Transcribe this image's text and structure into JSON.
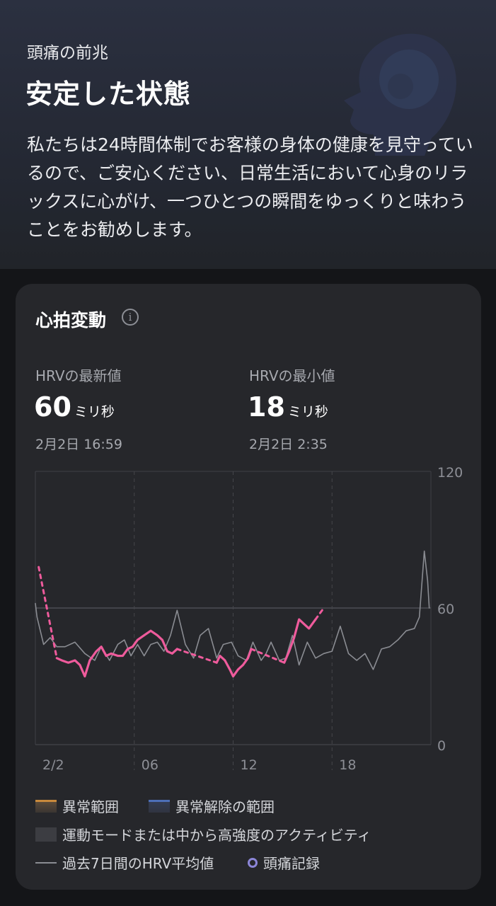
{
  "hero": {
    "eyebrow": "頭痛の前兆",
    "title": "安定した状態",
    "description": "私たちは24時間体制でお客様の身体の健康を見守っているので、ご安心ください、日常生活において心身のリラックスに心がけ、一つひとつの瞬間をゆっくりと味わうことをお勧めします。"
  },
  "card": {
    "title": "心拍変動",
    "info_icon": "info-icon",
    "latest": {
      "label": "HRVの最新値",
      "value": "60",
      "unit": "ミリ秒",
      "date": "2月2日 16:59"
    },
    "minimum": {
      "label": "HRVの最小値",
      "value": "18",
      "unit": "ミリ秒",
      "date": "2月2日 2:35"
    }
  },
  "legend": {
    "abnormal": "異常範囲",
    "abnormal_cleared": "異常解除の範囲",
    "activity": "運動モードまたは中から高強度のアクティビティ",
    "avg7": "過去7日間のHRV平均値",
    "headache": "頭痛記録"
  },
  "colors": {
    "accent": "#ef5b9c",
    "avg_line": "#8a8c92",
    "abnormal": "#c98a3c",
    "abnormal_cleared": "#4d6fb8",
    "headache_marker": "#8c86d8"
  },
  "chart_data": {
    "type": "line",
    "x_ticks": [
      "2/2",
      "06",
      "12",
      "18"
    ],
    "y_ticks": [
      "120",
      "60",
      "0"
    ],
    "ylim": [
      0,
      120
    ],
    "xlim": [
      0,
      24
    ],
    "reference_line": 60,
    "series": [
      {
        "name": "過去7日間のHRV平均値",
        "x": [
          0,
          0.1,
          0.5,
          0.9,
          1.3,
          1.8,
          2.4,
          3,
          3.6,
          4,
          4.5,
          5,
          5.4,
          5.8,
          6.2,
          6.6,
          7,
          7.4,
          7.8,
          8.2,
          8.6,
          9.1,
          9.6,
          10,
          10.5,
          11,
          11.4,
          11.9,
          12.3,
          12.8,
          13.2,
          13.7,
          14,
          14.3,
          14.8,
          15.2,
          15.6,
          16,
          16.5,
          17,
          17.5,
          18,
          18.5,
          19,
          19.5,
          20,
          20.5,
          21,
          21.5,
          22,
          22.5,
          23,
          23.3,
          23.6,
          23.8,
          23.9
        ],
        "y": [
          62,
          56,
          44,
          47,
          43,
          43,
          45,
          40,
          37,
          43,
          37,
          44,
          46,
          39,
          44,
          39,
          44,
          45,
          41,
          48,
          59,
          44,
          38,
          48,
          51,
          38,
          44,
          45,
          39,
          37,
          45,
          37,
          40,
          45,
          37,
          38,
          48,
          35,
          45,
          38,
          40,
          41,
          52,
          40,
          37,
          40,
          33,
          42,
          43,
          46,
          50,
          51,
          56,
          85,
          72,
          60
        ]
      },
      {
        "name": "HRV",
        "x": [
          1.3,
          1.6,
          2.0,
          2.4,
          2.7,
          3.0,
          3.3,
          3.7,
          4.0,
          4.3,
          4.6,
          5.0,
          5.3,
          5.6,
          5.9,
          6.2,
          6.6,
          7.0,
          7.4,
          7.7
        ],
        "y": [
          38,
          37,
          36,
          37,
          35,
          30,
          37,
          41,
          43,
          39,
          40,
          39,
          39,
          42,
          43,
          46,
          48,
          50,
          48,
          46
        ],
        "segment": 1
      },
      {
        "name": "HRV",
        "x": [
          7.7,
          8.0,
          8.3,
          8.6
        ],
        "y": [
          46,
          41,
          40,
          42
        ],
        "segment": 2
      },
      {
        "name": "HRV",
        "x": [
          11.0,
          11.2,
          11.5,
          11.8,
          12.0,
          12.3,
          12.6,
          12.9,
          13.1
        ],
        "y": [
          36,
          39,
          37,
          33,
          30,
          33,
          35,
          38,
          42
        ],
        "segment": 3
      },
      {
        "name": "HRV",
        "x": [
          15.1,
          15.4,
          15.7,
          16.0,
          16.3,
          16.6,
          17.0
        ],
        "y": [
          36,
          41,
          47,
          55,
          53,
          51,
          55
        ],
        "segment": 4
      }
    ],
    "gaps": [
      {
        "x": [
          0.2,
          1.3
        ],
        "y": [
          78,
          38
        ]
      },
      {
        "x": [
          8.6,
          11.0
        ],
        "y": [
          42,
          36
        ]
      },
      {
        "x": [
          13.1,
          15.1
        ],
        "y": [
          42,
          36
        ]
      },
      {
        "x": [
          17.0,
          17.5
        ],
        "y": [
          55,
          60
        ]
      }
    ]
  }
}
